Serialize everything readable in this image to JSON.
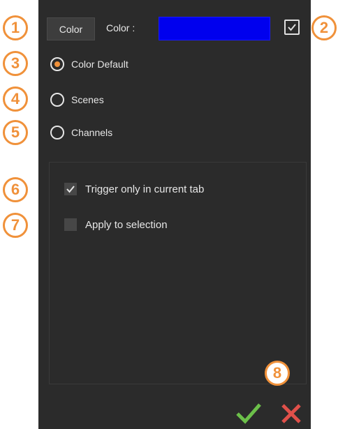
{
  "toolbar": {
    "color_button_label": "Color",
    "color_field_label": "Color :",
    "swatch_color": "#0000ee",
    "enable_checked": true
  },
  "radios": [
    {
      "label": "Color Default",
      "checked": true
    },
    {
      "label": "Scenes",
      "checked": false
    },
    {
      "label": "Channels",
      "checked": false
    }
  ],
  "options": [
    {
      "label": "Trigger only in current tab",
      "checked": true
    },
    {
      "label": "Apply to selection",
      "checked": false
    }
  ],
  "footer": {
    "ok_icon": "check-icon",
    "cancel_icon": "close-icon",
    "ok_color": "#6cc04a",
    "cancel_color": "#e0504a"
  },
  "annotations": {
    "color": "#f0913a",
    "badges": [
      "1",
      "2",
      "3",
      "4",
      "5",
      "6",
      "7",
      "8"
    ]
  }
}
